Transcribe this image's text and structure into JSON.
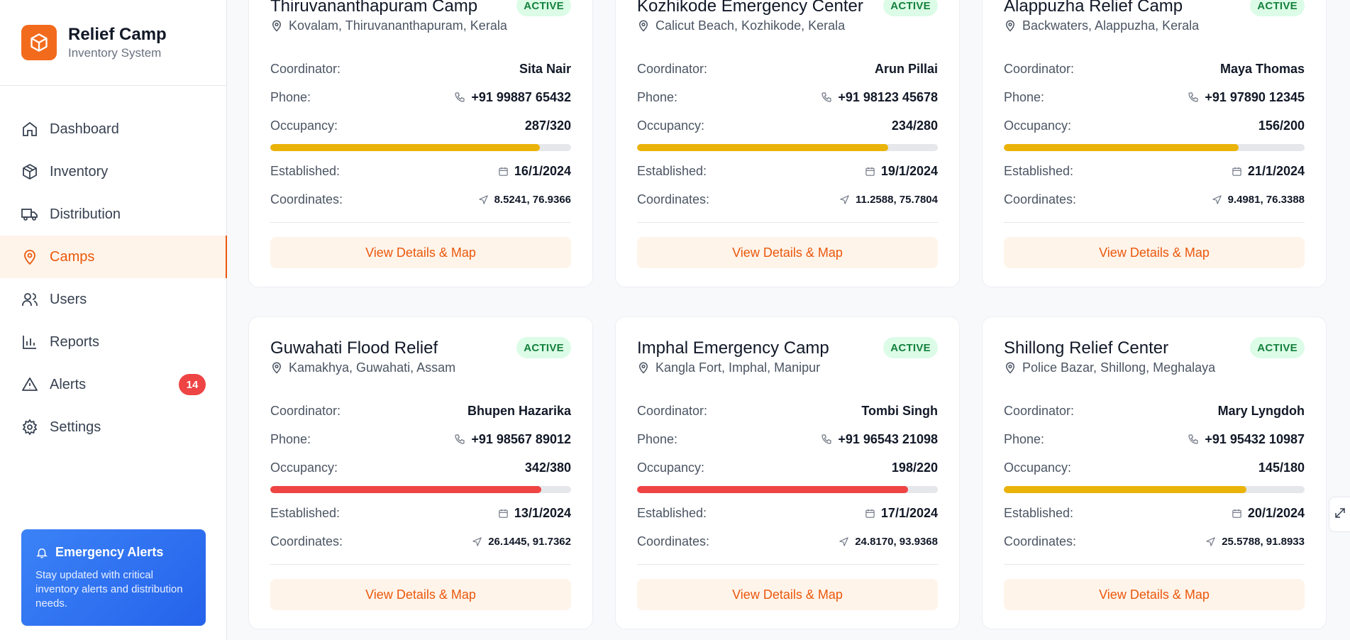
{
  "brand": {
    "title": "Relief Camp",
    "subtitle": "Inventory System",
    "accent": "#f26b1d"
  },
  "nav": [
    {
      "label": "Dashboard",
      "icon": "home-icon",
      "active": false
    },
    {
      "label": "Inventory",
      "icon": "box-icon",
      "active": false
    },
    {
      "label": "Distribution",
      "icon": "truck-icon",
      "active": false
    },
    {
      "label": "Camps",
      "icon": "map-pin-icon",
      "active": true
    },
    {
      "label": "Users",
      "icon": "users-icon",
      "active": false
    },
    {
      "label": "Reports",
      "icon": "bar-chart-icon",
      "active": false
    },
    {
      "label": "Alerts",
      "icon": "alert-triangle-icon",
      "active": false,
      "badge": "14"
    },
    {
      "label": "Settings",
      "icon": "gear-icon",
      "active": false
    }
  ],
  "emergency": {
    "title": "Emergency Alerts",
    "text": "Stay updated with critical inventory alerts and distribution needs."
  },
  "labels": {
    "coordinator": "Coordinator:",
    "phone": "Phone:",
    "occupancy": "Occupancy:",
    "established": "Established:",
    "coordinates": "Coordinates:",
    "button": "View Details & Map"
  },
  "colors": {
    "warning": "#eab308",
    "critical": "#ef4444",
    "active_bg": "#dcfce7",
    "active_text": "#15803d"
  },
  "camps": [
    {
      "name": "Thiruvananthapuram Camp",
      "status": "ACTIVE",
      "location": "Kovalam, Thiruvananthapuram, Kerala",
      "coordinator": "Sita Nair",
      "phone": "+91 99887 65432",
      "occupancy": "287/320",
      "occupancy_fraction": 0.897,
      "level": "warning",
      "established": "16/1/2024",
      "coordinates": "8.5241, 76.9366"
    },
    {
      "name": "Kozhikode Emergency Center",
      "status": "ACTIVE",
      "location": "Calicut Beach, Kozhikode, Kerala",
      "coordinator": "Arun Pillai",
      "phone": "+91 98123 45678",
      "occupancy": "234/280",
      "occupancy_fraction": 0.836,
      "level": "warning",
      "established": "19/1/2024",
      "coordinates": "11.2588, 75.7804"
    },
    {
      "name": "Alappuzha Relief Camp",
      "status": "ACTIVE",
      "location": "Backwaters, Alappuzha, Kerala",
      "coordinator": "Maya Thomas",
      "phone": "+91 97890 12345",
      "occupancy": "156/200",
      "occupancy_fraction": 0.78,
      "level": "warning",
      "established": "21/1/2024",
      "coordinates": "9.4981, 76.3388"
    },
    {
      "name": "Guwahati Flood Relief",
      "status": "ACTIVE",
      "location": "Kamakhya, Guwahati, Assam",
      "coordinator": "Bhupen Hazarika",
      "phone": "+91 98567 89012",
      "occupancy": "342/380",
      "occupancy_fraction": 0.9,
      "level": "critical",
      "established": "13/1/2024",
      "coordinates": "26.1445, 91.7362"
    },
    {
      "name": "Imphal Emergency Camp",
      "status": "ACTIVE",
      "location": "Kangla Fort, Imphal, Manipur",
      "coordinator": "Tombi Singh",
      "phone": "+91 96543 21098",
      "occupancy": "198/220",
      "occupancy_fraction": 0.9,
      "level": "critical",
      "established": "17/1/2024",
      "coordinates": "24.8170, 93.9368"
    },
    {
      "name": "Shillong Relief Center",
      "status": "ACTIVE",
      "location": "Police Bazar, Shillong, Meghalaya",
      "coordinator": "Mary Lyngdoh",
      "phone": "+91 95432 10987",
      "occupancy": "145/180",
      "occupancy_fraction": 0.806,
      "level": "warning",
      "established": "20/1/2024",
      "coordinates": "25.5788, 91.8933"
    }
  ]
}
